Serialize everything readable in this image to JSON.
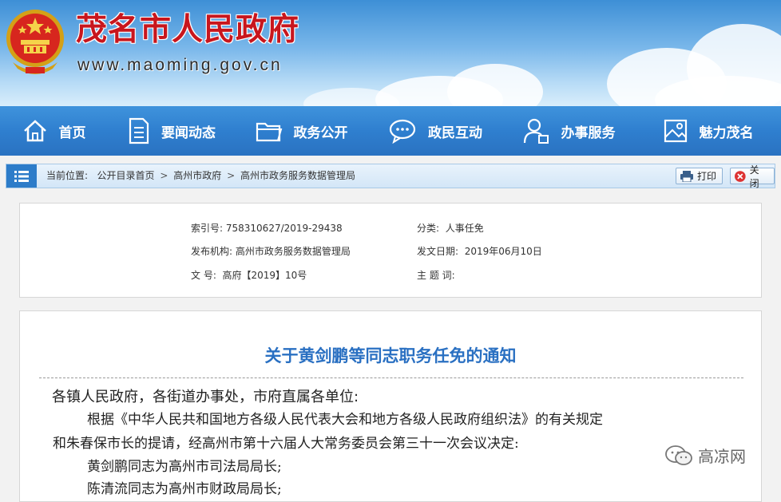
{
  "header": {
    "title": "茂名市人民政府",
    "url": "www.maoming.gov.cn"
  },
  "nav": [
    {
      "label": "首页",
      "icon": "home-icon"
    },
    {
      "label": "要闻动态",
      "icon": "document-icon"
    },
    {
      "label": "政务公开",
      "icon": "folder-icon"
    },
    {
      "label": "政民互动",
      "icon": "chat-icon"
    },
    {
      "label": "办事服务",
      "icon": "user-service-icon"
    },
    {
      "label": "魅力茂名",
      "icon": "picture-icon"
    }
  ],
  "breadcrumb": {
    "prefix": "当前位置:",
    "items": [
      "公开目录首页",
      "高州市政府",
      "高州市政务服务数据管理局"
    ],
    "separator": ">",
    "print_label": "打印",
    "close_label": "关闭"
  },
  "info": {
    "index_label": "索引号:",
    "index_value": "758310627/2019-29438",
    "category_label": "分类:",
    "category_value": "人事任免",
    "publisher_label": "发布机构:",
    "publisher_value": "高州市政务服务数据管理局",
    "date_label": "发文日期:",
    "date_value": "2019年06月10日",
    "docno_label": "文 号:",
    "docno_value": "高府【2019】10号",
    "subject_label": "主 题 词:",
    "subject_value": ""
  },
  "article": {
    "title": "关于黄剑鹏等同志职务任免的通知",
    "salutation": "各镇人民政府，各街道办事处，市府直属各单位:",
    "para1_line1": "根据《中华人民共和国地方各级人民代表大会和地方各级人民政府组织法》的有关规定",
    "para1_line2": "和朱春保市长的提请，经高州市第十六届人大常务委员会第三十一次会议决定:",
    "item1": "黄剑鹏同志为高州市司法局局长;",
    "item2": "陈清流同志为高州市财政局局长;"
  },
  "watermark": "高凉网",
  "colors": {
    "title_red": "#c8161d",
    "nav_blue": "#2f7fcf",
    "article_title_blue": "#2a70c2"
  }
}
